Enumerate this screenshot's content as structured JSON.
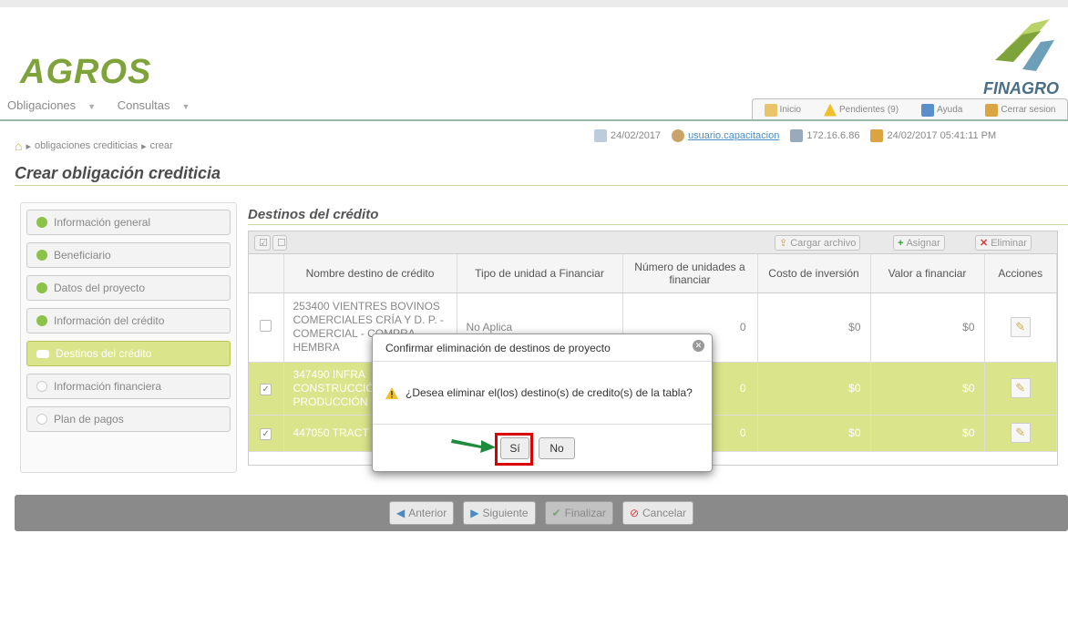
{
  "app": {
    "logo_left": "AGROS",
    "logo_right": "FINAGRO"
  },
  "menu": [
    {
      "label": "Obligaciones"
    },
    {
      "label": "Consultas"
    }
  ],
  "toplinks": [
    {
      "label": "Inicio",
      "icon": "home-icon"
    },
    {
      "label": "Pendientes (9)",
      "icon": "warning-icon"
    },
    {
      "label": "Ayuda",
      "icon": "help-icon"
    },
    {
      "label": "Cerrar sesion",
      "icon": "exit-icon"
    }
  ],
  "breadcrumb": {
    "items": [
      "obligaciones crediticias",
      "crear"
    ]
  },
  "status": {
    "date": "24/02/2017",
    "user": "usuario.capacitacion",
    "ip": "172.16.6.86",
    "datetime": "24/02/2017 05:41:11 PM"
  },
  "page_title": "Crear obligación crediticia",
  "steps": [
    {
      "label": "Información general",
      "state": "done"
    },
    {
      "label": "Beneficiario",
      "state": "done"
    },
    {
      "label": "Datos del proyecto",
      "state": "done"
    },
    {
      "label": "Información del crédito",
      "state": "done"
    },
    {
      "label": "Destinos del crédito",
      "state": "current"
    },
    {
      "label": "Información financiera",
      "state": "pending"
    },
    {
      "label": "Plan de pagos",
      "state": "pending"
    }
  ],
  "section_title": "Destinos del crédito",
  "table_toolbar": {
    "upload": "Cargar archivo",
    "assign": "Asignar",
    "delete": "Eliminar"
  },
  "table": {
    "headers": [
      "Nombre destino de crédito",
      "Tipo de unidad a Financiar",
      "Número de unidades a financiar",
      "Costo de inversión",
      "Valor a financiar",
      "Acciones"
    ],
    "rows": [
      {
        "name": "253400 VIENTRES BOVINOS COMERCIALES CRÍA Y D. P. - COMERCIAL - COMPRA - HEMBRA",
        "unit": "No Aplica",
        "units": "0",
        "cost": "$0",
        "value": "$0",
        "checked": false
      },
      {
        "name": "347490 INFRA CONSTRUCCIÓ PRODUCCIÓN",
        "unit": "",
        "units": "0",
        "cost": "$0",
        "value": "$0",
        "checked": true
      },
      {
        "name": "447050 TRACT COMPRA",
        "unit": "",
        "units": "0",
        "cost": "$0",
        "value": "$0",
        "checked": true
      }
    ]
  },
  "footer": {
    "prev": "Anterior",
    "next": "Siguiente",
    "finish": "Finalizar",
    "cancel": "Cancelar"
  },
  "dialog": {
    "title": "Confirmar eliminación de destinos de proyecto",
    "message": "¿Desea eliminar el(los) destino(s) de credito(s) de la tabla?",
    "yes": "Sí",
    "no": "No"
  },
  "colors": {
    "brand_green": "#7ea33a",
    "selected_row": "#d9e48b",
    "highlight": "#d90000",
    "arrow": "#1e8a3c"
  }
}
